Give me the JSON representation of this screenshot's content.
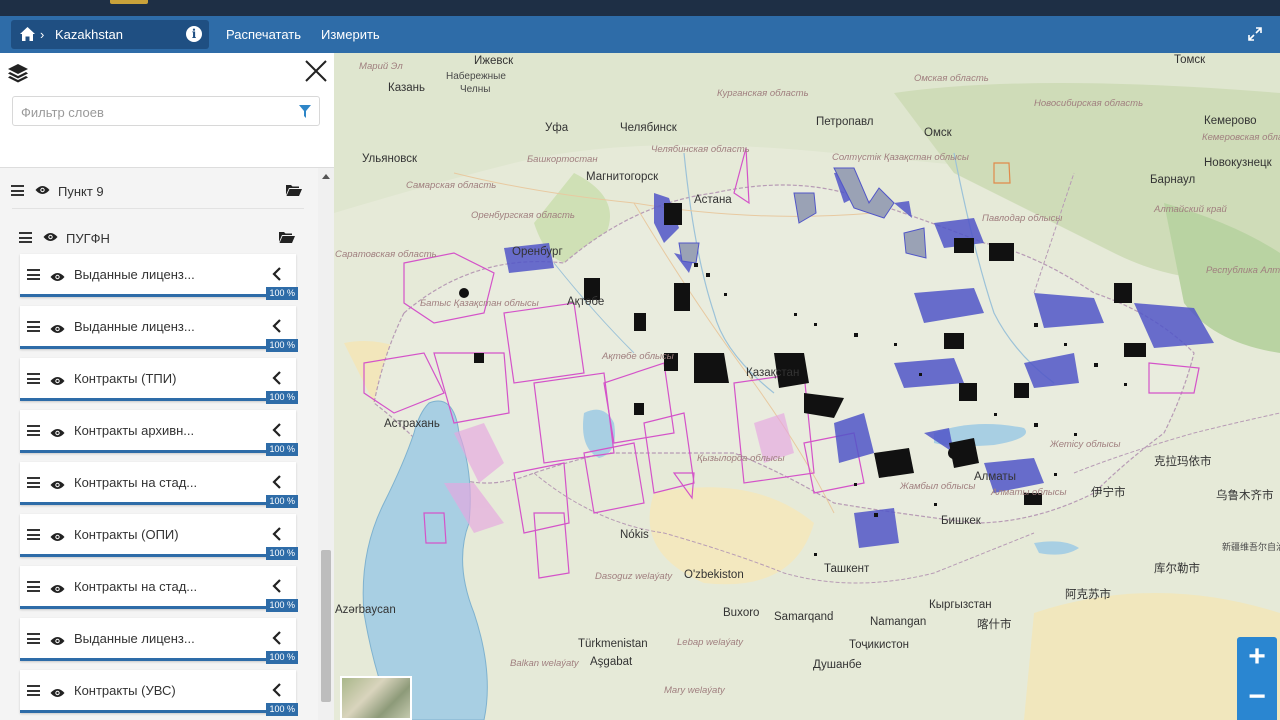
{
  "toolbar": {
    "breadcrumb": "Kazakhstan",
    "print_label": "Распечатать",
    "measure_label": "Измерить"
  },
  "panel": {
    "filter_placeholder": "Фильтр слоев",
    "groups": [
      {
        "name": "Пункт 9"
      },
      {
        "name": "ПУГФН"
      }
    ],
    "layers": [
      {
        "name": "Выданные лиценз...",
        "opacity": "100 %"
      },
      {
        "name": "Выданные лиценз...",
        "opacity": "100 %"
      },
      {
        "name": "Контракты (ТПИ)",
        "opacity": "100 %"
      },
      {
        "name": "Контракты архивн...",
        "opacity": "100 %"
      },
      {
        "name": "Контракты на стад...",
        "opacity": "100 %"
      },
      {
        "name": "Контракты (ОПИ)",
        "opacity": "100 %"
      },
      {
        "name": "Контракты на стад...",
        "opacity": "100 %"
      },
      {
        "name": "Выданные лиценз...",
        "opacity": "100 %"
      },
      {
        "name": "Контракты (УВС)",
        "opacity": "100 %"
      }
    ]
  },
  "map": {
    "labels": [
      {
        "text": "Ижевск"
      },
      {
        "text": "Марий Эл"
      },
      {
        "text": "Набережные"
      },
      {
        "text": "Челны"
      },
      {
        "text": "Казань"
      },
      {
        "text": "Уфа"
      },
      {
        "text": "Челябинск"
      },
      {
        "text": "Петропавл"
      },
      {
        "text": "Омск"
      },
      {
        "text": "Томск"
      },
      {
        "text": "Кемерово"
      },
      {
        "text": "Новокузнецк"
      },
      {
        "text": "Барнаул"
      },
      {
        "text": "Ульяновск"
      },
      {
        "text": "Магнитогорск"
      },
      {
        "text": "Оренбург"
      },
      {
        "text": "Астана"
      },
      {
        "text": "Ақтөбе"
      },
      {
        "text": "Қазақстан"
      },
      {
        "text": "Астрахань"
      },
      {
        "text": "Алматы"
      },
      {
        "text": "Бишкек"
      },
      {
        "text": "Ташкент"
      },
      {
        "text": "Nókis"
      },
      {
        "text": "O'zbekiston"
      },
      {
        "text": "Buxoro"
      },
      {
        "text": "Samarqand"
      },
      {
        "text": "Namangan"
      },
      {
        "text": "Кыргызстан"
      },
      {
        "text": "Тоҷикистон"
      },
      {
        "text": "Душанбе"
      },
      {
        "text": "Türkmenistan"
      },
      {
        "text": "Aşgabat"
      },
      {
        "text": "Azərbaycan"
      },
      {
        "text": "克拉玛依市"
      },
      {
        "text": "乌鲁木齐市"
      },
      {
        "text": "伊宁市"
      },
      {
        "text": "库尔勒市"
      },
      {
        "text": "阿克苏市"
      },
      {
        "text": "喀什市"
      },
      {
        "text": "新疆维吾尔自治区"
      }
    ],
    "regions": [
      {
        "text": "Омская область"
      },
      {
        "text": "Новосибирская область"
      },
      {
        "text": "Курганская область"
      },
      {
        "text": "Башкортостан"
      },
      {
        "text": "Челябинская область"
      },
      {
        "text": "Оренбургская область"
      },
      {
        "text": "Самарская область"
      },
      {
        "text": "Саратовская область"
      },
      {
        "text": "Батыс Қазақстан облысы"
      },
      {
        "text": "Алтайский край"
      },
      {
        "text": "Республика Алтай"
      },
      {
        "text": "Кемеровская область"
      },
      {
        "text": "Павлодар облысы"
      },
      {
        "text": "Солтүстік Қазақстан облысы"
      },
      {
        "text": "Ақтөбе облысы"
      },
      {
        "text": "Қызылорда облысы"
      },
      {
        "text": "Жамбыл облысы"
      },
      {
        "text": "Алматы облысы"
      },
      {
        "text": "Жетісу облысы"
      },
      {
        "text": "Dasoguz welaýaty"
      },
      {
        "text": "Lebap welaýaty"
      },
      {
        "text": "Balkan welaýaty"
      },
      {
        "text": "Mary welaýaty"
      }
    ]
  },
  "zoom": {
    "plus": "+",
    "minus": "−"
  },
  "colors": {
    "toolbar": "#2e6ca8",
    "crumb": "#1f4f82",
    "bar": "#2e6ca8",
    "zoom": "#2a86d1"
  }
}
